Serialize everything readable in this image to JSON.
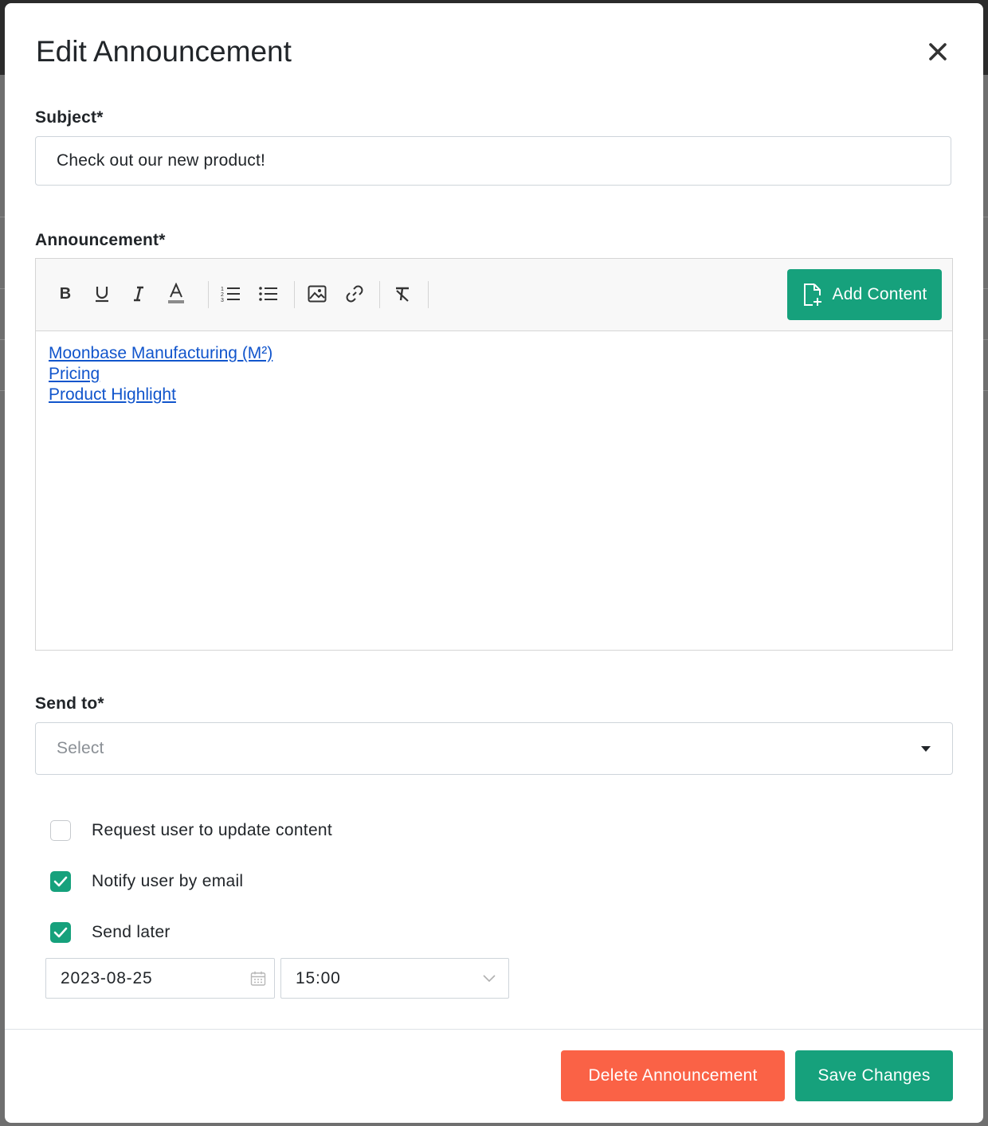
{
  "modal": {
    "title": "Edit Announcement"
  },
  "subject": {
    "label": "Subject*",
    "value": "Check out our new product!"
  },
  "announcement": {
    "label": "Announcement*",
    "toolbar": {
      "buttons": [
        "bold-icon",
        "underline-icon",
        "italic-icon",
        "font-color-icon",
        "ordered-list-icon",
        "bullet-list-icon",
        "image-icon",
        "link-icon",
        "clear-format-icon"
      ],
      "add_content_label": "Add Content"
    },
    "links": [
      "Moonbase Manufacturing (M²)",
      "Pricing",
      "Product Highlight"
    ],
    "link_color": "#1155cc"
  },
  "send_to": {
    "label": "Send to*",
    "placeholder": "Select"
  },
  "options": [
    {
      "label": "Request user to update content",
      "checked": false
    },
    {
      "label": "Notify user by email",
      "checked": true
    },
    {
      "label": "Send later",
      "checked": true
    }
  ],
  "schedule": {
    "date": "2023-08-25",
    "time": "15:00"
  },
  "footer": {
    "delete_label": "Delete Announcement",
    "save_label": "Save Changes"
  },
  "colors": {
    "primary": "#16a17c",
    "danger": "#fa6246"
  }
}
